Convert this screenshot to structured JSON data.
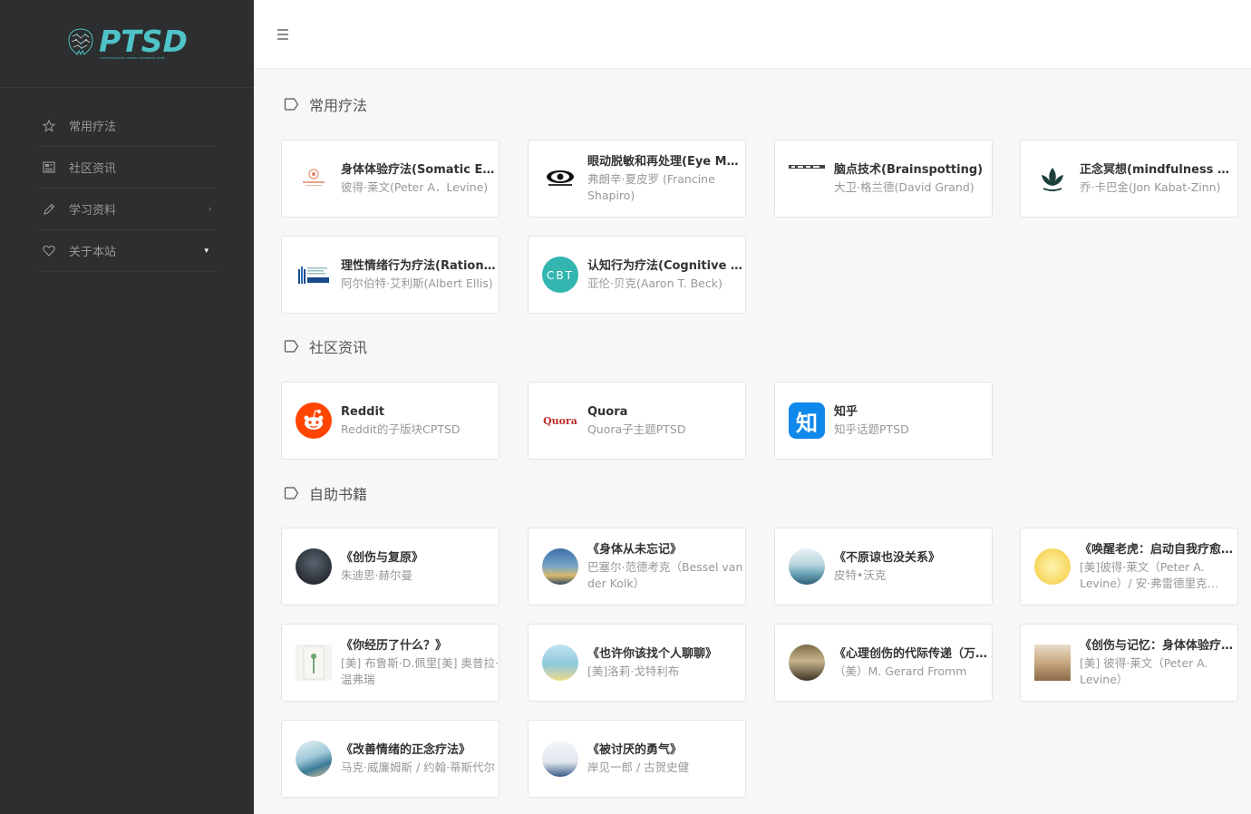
{
  "logo": {
    "text": "PTSD",
    "subtitle": "POSTTRAUMATIC STRESS DISORDER ZONE"
  },
  "sidebar": {
    "items": [
      {
        "label": "常用疗法",
        "icon": "star-icon"
      },
      {
        "label": "社区资讯",
        "icon": "newspaper-icon"
      },
      {
        "label": "学习资料",
        "icon": "pencil-icon",
        "arrow": "›"
      },
      {
        "label": "关于本站",
        "icon": "heart-icon",
        "caret": "▾"
      }
    ]
  },
  "sections": {
    "therapy": {
      "title": "常用疗法",
      "cards": [
        {
          "title": "身体体验疗法(Somatic Experiencing)",
          "desc": "彼得·莱文(Peter A．Levine)"
        },
        {
          "title": "眼动脱敏和再处理(Eye Movement Desensitization and Reprocessing)",
          "desc": "弗朗辛·夏皮罗 (Francine Shapiro)"
        },
        {
          "title": "脑点技术(Brainspotting)",
          "desc": "大卫·格兰德(David Grand)"
        },
        {
          "title": "正念冥想(mindfulness based stress reduction)",
          "desc": "乔·卡巴金(Jon Kabat-Zinn)"
        },
        {
          "title": "理性情绪行为疗法(Rational Emotive Behavior Therapy)",
          "desc": "阿尔伯特·艾利斯(Albert Ellis)"
        },
        {
          "title": "认知行为疗法(Cognitive Behavioral Therapy)",
          "desc": "亚伦·贝克(Aaron T. Beck)"
        }
      ]
    },
    "community": {
      "title": "社区资讯",
      "cards": [
        {
          "title": "Reddit",
          "desc": "Reddit的子版块CPTSD"
        },
        {
          "title": "Quora",
          "desc": "Quora子主题PTSD",
          "logo_text": "Quora"
        },
        {
          "title": "知乎",
          "desc": "知乎话题PTSD",
          "logo_text": "知"
        }
      ]
    },
    "books": {
      "title": "自助书籍",
      "cards": [
        {
          "title": "《创伤与复原》",
          "desc": "朱迪思·赫尔曼"
        },
        {
          "title": "《身体从未忘记》",
          "desc": "巴塞尔·范德考克（Bessel van der Kolk）"
        },
        {
          "title": "《不原谅也没关系》",
          "desc": "皮特•沃克"
        },
        {
          "title": "《唤醒老虎：启动自我疗愈本能》",
          "desc": "[美]彼得·莱文（Peter A. Levine）/ 安·弗雷德里克（Ann Frederick）"
        },
        {
          "title": "《你经历了什么？》",
          "desc": "[美] 布鲁斯·D.佩里[美] 奥普拉·温弗瑞"
        },
        {
          "title": "《也许你该找个人聊聊》",
          "desc": "[美]洛莉·戈特利布"
        },
        {
          "title": "《心理创伤的代际传递（万千心理）》",
          "desc": "（美）M. Gerard Fromm"
        },
        {
          "title": "《创伤与记忆：身体体验疗法如何重塑创伤记忆》",
          "desc": "[美] 彼得·莱文（Peter A. Levine）"
        },
        {
          "title": "《改善情绪的正念疗法》",
          "desc": "马克·威廉姆斯 / 约翰·蒂斯代尔"
        },
        {
          "title": "《被讨厌的勇气》",
          "desc": "岸见一郎 / 古贺史健"
        }
      ]
    }
  },
  "colors": {
    "sidebar_bg": "#2c2e2f",
    "accent": "#4fc3c7",
    "reddit": "#ff4500",
    "quora": "#b92b27",
    "zhihu": "#0f88eb"
  }
}
